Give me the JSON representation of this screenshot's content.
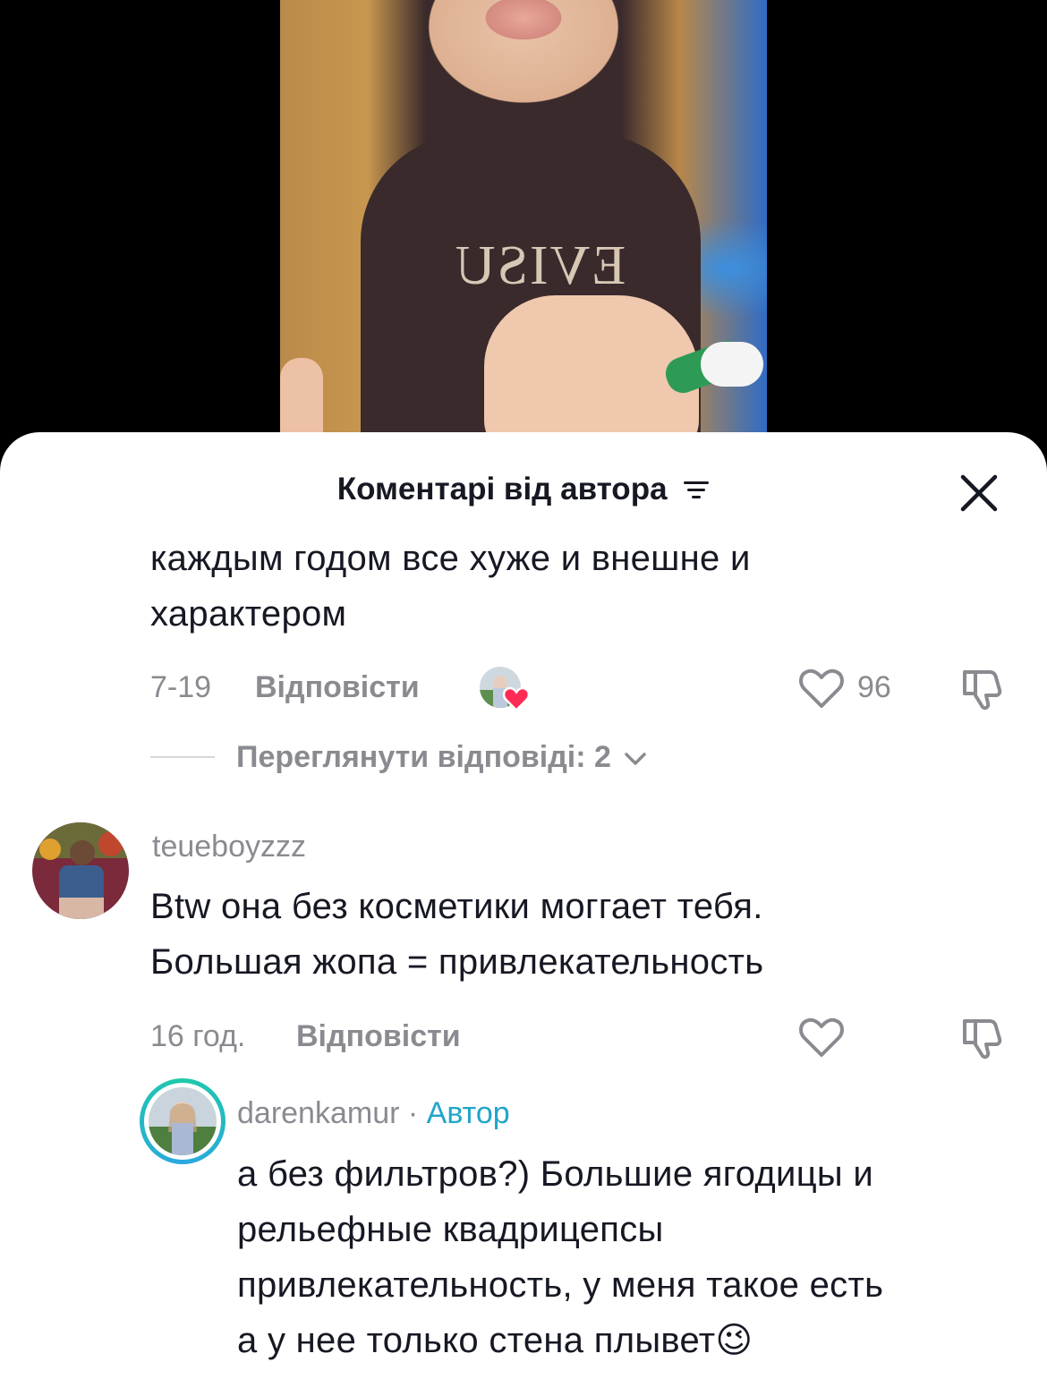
{
  "header": {
    "title": "Коментарі від автора"
  },
  "comments": [
    {
      "text_line1": "каждым годом все хуже и внешне и",
      "text_line2": "характером",
      "date": "7-19",
      "reply_label": "Відповісти",
      "likes": "96",
      "view_replies": "Переглянути відповіді: 2"
    },
    {
      "username": "teueboyzzz",
      "text_line1": "Btw она без косметики моггает тебя.",
      "text_line2": "Большая жопа = привлекательность",
      "date": "16 год.",
      "reply_label": "Відповісти"
    }
  ],
  "reply": {
    "username": "darenkamur",
    "separator": " · ",
    "author_tag": "Автор",
    "text_line1": "а без фильтров?) Большие ягодицы и",
    "text_line2": "рельефные квадрицепсы",
    "text_line3": "привлекательность, у меня такое есть",
    "text_line4": "а у нее только стена плывет",
    "emoji": "😉"
  },
  "colors": {
    "accent": "#20a5c9",
    "heart": "#fe2c55",
    "muted": "#8a8b91"
  }
}
